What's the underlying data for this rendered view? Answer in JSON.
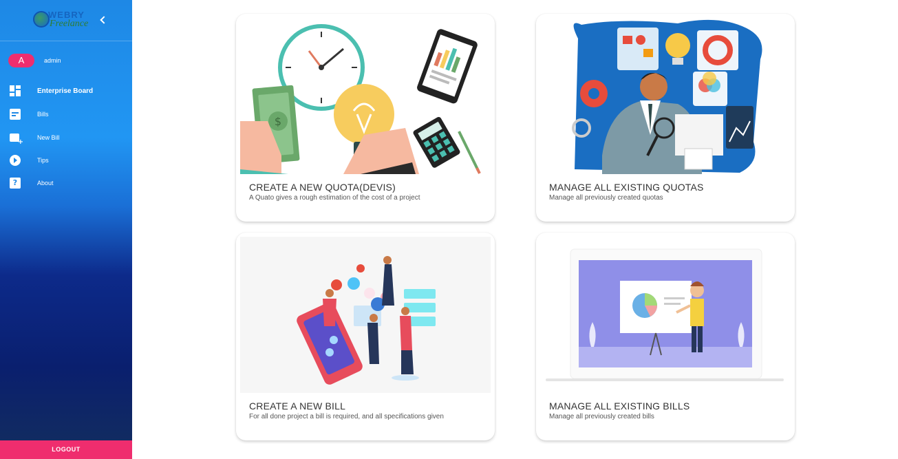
{
  "brand": {
    "logo_top": "WEBRY",
    "logo_bottom": "Freelance",
    "logo_icon": "globe-logo"
  },
  "user": {
    "initial": "A",
    "name": "admin"
  },
  "nav": {
    "items": [
      {
        "label": "Enterprise Board",
        "icon": "dashboard-icon"
      },
      {
        "label": "Bills",
        "icon": "bill-icon"
      },
      {
        "label": "New Bill",
        "icon": "new-bill-icon"
      },
      {
        "label": "Tips",
        "icon": "play-circle-icon"
      },
      {
        "label": "About",
        "icon": "help-icon"
      }
    ]
  },
  "logout_label": "LOGOUT",
  "cards": [
    {
      "title": "CREATE A NEW QUOTA(DEVIS)",
      "subtitle": "A Quato gives a rough estimation of the cost of a project"
    },
    {
      "title": "MANAGE ALL EXISTING QUOTAS",
      "subtitle": "Manage all previously created quotas"
    },
    {
      "title": "CREATE A NEW BILL",
      "subtitle": "For all done project a bill is required, and all specifications given"
    },
    {
      "title": "MANAGE ALL EXISTING BILLS",
      "subtitle": "Manage all previously created bills"
    }
  ],
  "colors": {
    "sidebar_top": "#1e88e5",
    "sidebar_bottom": "#0a1f6e",
    "accent": "#ef2d6e"
  }
}
